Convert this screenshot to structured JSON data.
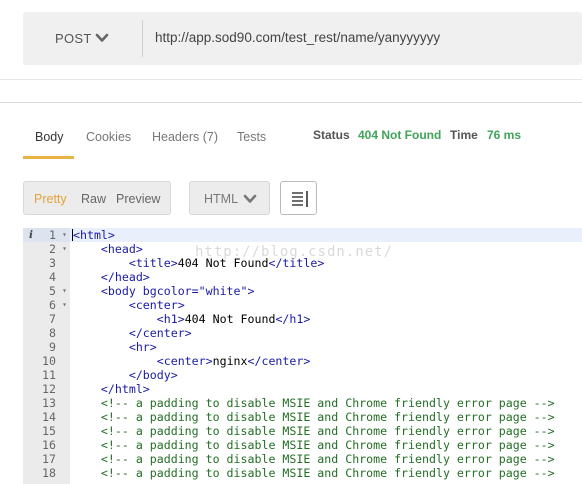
{
  "request": {
    "method": "POST",
    "url": "http://app.sod90.com/test_rest/name/yanyyyyyy"
  },
  "tabs": [
    {
      "label": "Body",
      "active": true
    },
    {
      "label": "Cookies",
      "active": false
    },
    {
      "label": "Headers (7)",
      "active": false
    },
    {
      "label": "Tests",
      "active": false
    }
  ],
  "status": {
    "status_label": "Status",
    "status_value": "404 Not Found",
    "time_label": "Time",
    "time_value": "76 ms"
  },
  "toolbar": {
    "formats": [
      "Pretty",
      "Raw",
      "Preview"
    ],
    "active_format": "Pretty",
    "language": "HTML",
    "wrap_icon": "wrap-lines-icon"
  },
  "editor": {
    "info_marker": "i",
    "lines": [
      {
        "n": "1",
        "fold": true,
        "text": "<html>"
      },
      {
        "n": "2",
        "fold": true,
        "text": "    <head>"
      },
      {
        "n": "3",
        "fold": false,
        "text": "        <title>404 Not Found</title>"
      },
      {
        "n": "4",
        "fold": false,
        "text": "    </head>"
      },
      {
        "n": "5",
        "fold": true,
        "text": "    <body bgcolor=\"white\">"
      },
      {
        "n": "6",
        "fold": true,
        "text": "        <center>"
      },
      {
        "n": "7",
        "fold": false,
        "text": "            <h1>404 Not Found</h1>"
      },
      {
        "n": "8",
        "fold": false,
        "text": "        </center>"
      },
      {
        "n": "9",
        "fold": false,
        "text": "        <hr>"
      },
      {
        "n": "10",
        "fold": false,
        "text": "            <center>nginx</center>"
      },
      {
        "n": "11",
        "fold": false,
        "text": "        </body>"
      },
      {
        "n": "12",
        "fold": false,
        "text": "    </html>"
      },
      {
        "n": "13",
        "fold": false,
        "text": "    <!-- a padding to disable MSIE and Chrome friendly error page -->"
      },
      {
        "n": "14",
        "fold": false,
        "text": "    <!-- a padding to disable MSIE and Chrome friendly error page -->"
      },
      {
        "n": "15",
        "fold": false,
        "text": "    <!-- a padding to disable MSIE and Chrome friendly error page -->"
      },
      {
        "n": "16",
        "fold": false,
        "text": "    <!-- a padding to disable MSIE and Chrome friendly error page -->"
      },
      {
        "n": "17",
        "fold": false,
        "text": "    <!-- a padding to disable MSIE and Chrome friendly error page -->"
      },
      {
        "n": "18",
        "fold": false,
        "text": "    <!-- a padding to disable MSIE and Chrome friendly error page -->"
      }
    ]
  },
  "watermark": "http://blog.csdn.net/",
  "colors": {
    "accent": "#e8b245",
    "status_ok": "#3fa35a",
    "tag": "#1a1aa6",
    "comment": "#236e25"
  }
}
